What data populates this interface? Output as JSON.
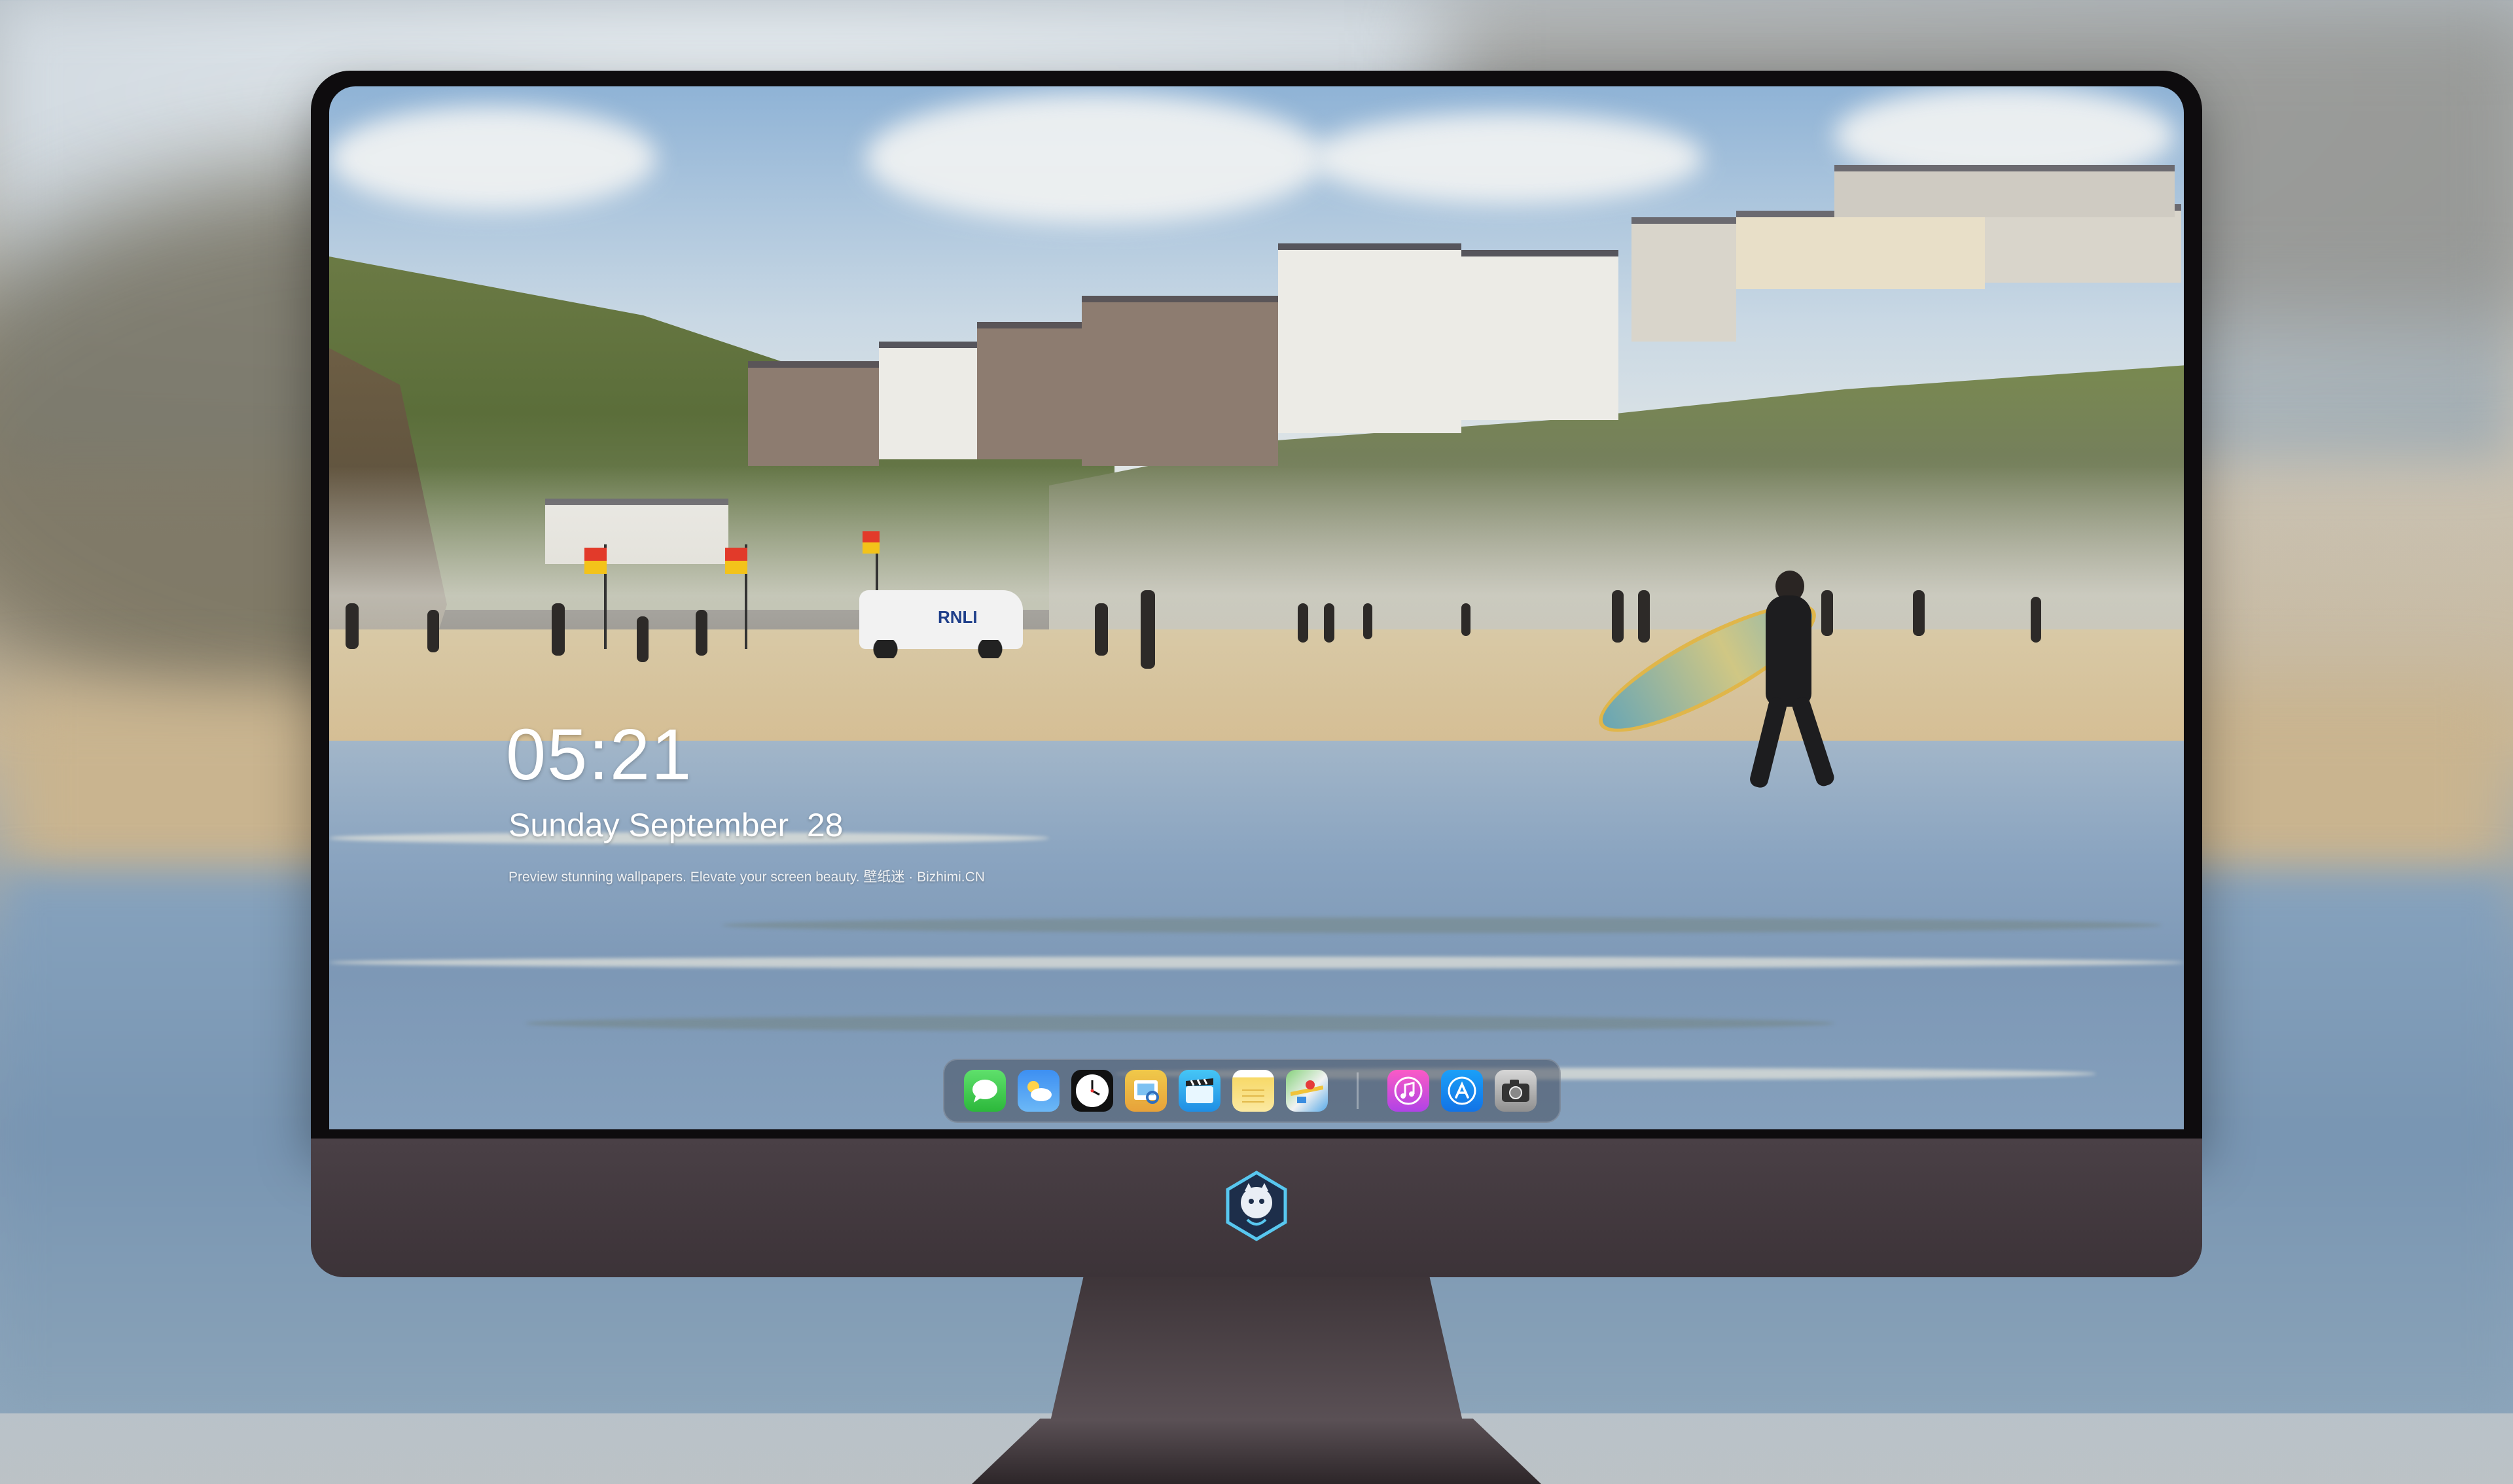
{
  "lockscreen": {
    "time": "05:21",
    "date": "Sunday September  28",
    "tagline": "Preview stunning wallpapers. Elevate your screen beauty. 壁纸迷 · Bizhimi.CN"
  },
  "scene": {
    "truck_label": "RNLI"
  },
  "dock": {
    "apps": [
      {
        "name": "Messages",
        "icon": "messages-icon"
      },
      {
        "name": "Weather",
        "icon": "weather-icon"
      },
      {
        "name": "Clock",
        "icon": "clock-icon"
      },
      {
        "name": "Preview",
        "icon": "preview-icon"
      },
      {
        "name": "Clips",
        "icon": "clips-icon"
      },
      {
        "name": "Notes",
        "icon": "notes-icon"
      },
      {
        "name": "Maps",
        "icon": "maps-icon"
      },
      {
        "name": "Music",
        "icon": "music-icon"
      },
      {
        "name": "App Store",
        "icon": "app-store-icon"
      },
      {
        "name": "Camera",
        "icon": "camera-icon"
      }
    ]
  },
  "colors": {
    "bezel": "#0e0c0e",
    "chin": "#443a40",
    "dock_bg": "#464e5f"
  }
}
